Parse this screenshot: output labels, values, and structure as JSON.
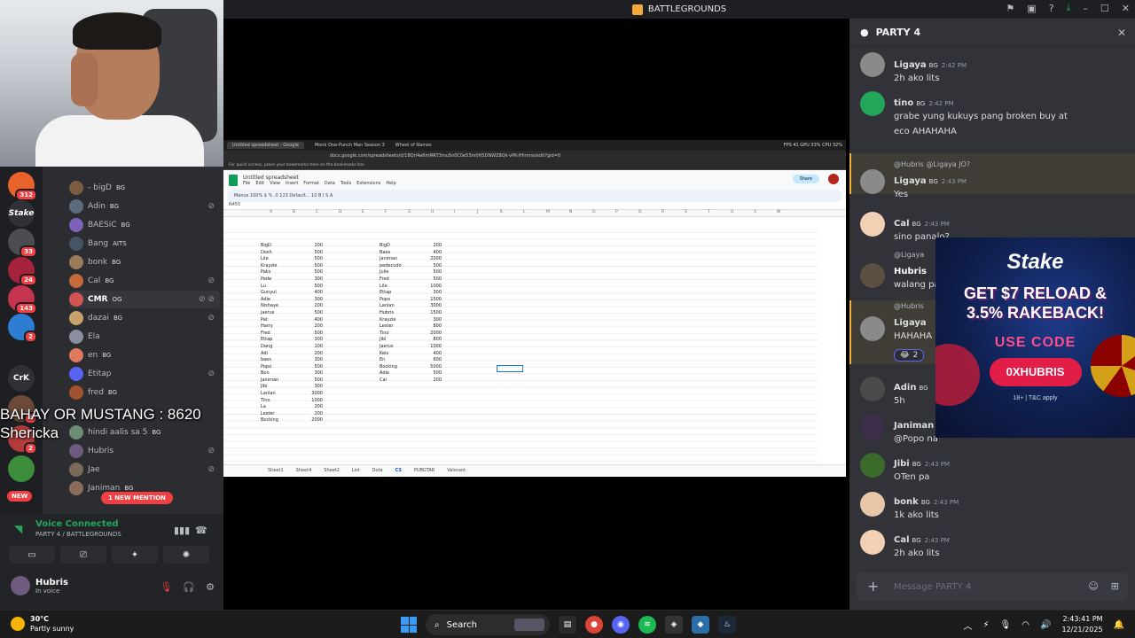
{
  "window": {
    "title": "BATTLEGROUNDS"
  },
  "overlay": {
    "line1": "BAHAY OR MUSTANG : 8620",
    "line2": "Shericka"
  },
  "rail": {
    "badges": [
      "312",
      "33",
      "24",
      "143",
      "2",
      "4",
      "2"
    ],
    "labels": [
      "Stake",
      "CrK"
    ],
    "new_label": "NEW"
  },
  "members": {
    "items": [
      {
        "name": "- bigD",
        "tag": "BG"
      },
      {
        "name": "Adin",
        "tag": "BG"
      },
      {
        "name": "BAESiC",
        "tag": "BG"
      },
      {
        "name": "Bang",
        "tag": "AITS"
      },
      {
        "name": "bonk",
        "tag": "BG"
      },
      {
        "name": "Cal",
        "tag": "BG"
      },
      {
        "name": "CMR",
        "tag": "OG"
      },
      {
        "name": "dazai",
        "tag": "BG"
      },
      {
        "name": "Ela",
        "tag": ""
      },
      {
        "name": "en",
        "tag": "BG"
      },
      {
        "name": "Etitap",
        "tag": ""
      },
      {
        "name": "fred",
        "tag": "BG"
      },
      {
        "name": "hindi aalis sa 5",
        "tag": "BG"
      },
      {
        "name": "Hubris",
        "tag": ""
      },
      {
        "name": "Jae",
        "tag": ""
      },
      {
        "name": "Janiman",
        "tag": "BG"
      }
    ],
    "mention_pill": "1 NEW MENTION"
  },
  "voice": {
    "status": "Voice Connected",
    "channel": "PARTY 4 / BATTLEGROUNDS",
    "user_name": "Hubris",
    "user_status": "In voice"
  },
  "stream": {
    "tabs": [
      "Untitled spreadsheet - Google",
      "Monk One-Punch Man Season 3",
      "Wheel of Names"
    ],
    "fps": "FPS 41   GPU 33%   CPU 32%",
    "url": "docs.google.com/spreadsheets/d/1BQrl4a6mMKT3mu5n0C0e53m0H5DNWZ8Qk-vPK-Hfmmo/edit?gid=0",
    "bookmark_bar": "For quick access, place your bookmarks here on the bookmarks bar.",
    "sheet_title": "Untitled spreadsheet",
    "menus": [
      "File",
      "Edit",
      "View",
      "Insert",
      "Format",
      "Data",
      "Tools",
      "Extensions",
      "Help"
    ],
    "share_label": "Share",
    "toolbar_text": "Menus   100%   $   %   .0   123   Default...   10   B   I   S   A",
    "cell_ref": "N455",
    "col_letters": [
      "A",
      "B",
      "C",
      "D",
      "E",
      "F",
      "G",
      "H",
      "I",
      "J",
      "K",
      "L",
      "M",
      "N",
      "O",
      "P",
      "Q",
      "R",
      "S",
      "T",
      "U",
      "V",
      "W"
    ],
    "left_table": [
      [
        "BigD",
        "200"
      ],
      [
        "Dosh",
        "500"
      ],
      [
        "Lile",
        "500"
      ],
      [
        "Krayzie",
        "500"
      ],
      [
        "Paks",
        "500"
      ],
      [
        "Pede",
        "300"
      ],
      [
        "Lu",
        "500"
      ],
      [
        "Gunyul",
        "400"
      ],
      [
        "Adie",
        "300"
      ],
      [
        "Nishaye",
        "200"
      ],
      [
        "jaerus",
        "500"
      ],
      [
        "Pat",
        "400"
      ],
      [
        "Harry",
        "200"
      ],
      [
        "Fred",
        "500"
      ],
      [
        "Ettap",
        "300"
      ],
      [
        "Dang",
        "100"
      ],
      [
        "Adi",
        "200"
      ],
      [
        "baes",
        "300"
      ],
      [
        "Popo",
        "500"
      ],
      [
        "Bon",
        "300"
      ],
      [
        "Janiman",
        "500"
      ],
      [
        "Jibi",
        "300"
      ],
      [
        "Lanlan",
        "3000"
      ],
      [
        "Tino",
        "1000"
      ],
      [
        "La",
        "200"
      ],
      [
        "Lester",
        "200"
      ],
      [
        "Bocking",
        "2000"
      ]
    ],
    "right_table": [
      [
        "BigD",
        "200"
      ],
      [
        "Baes",
        "400"
      ],
      [
        "Janiman",
        "2000"
      ],
      [
        "pedecudo",
        "500"
      ],
      [
        "Julie",
        "500"
      ],
      [
        "Fred",
        "500"
      ],
      [
        "Lile",
        "1000"
      ],
      [
        "Ettap",
        "300"
      ],
      [
        "Popo",
        "1500"
      ],
      [
        "Lanlan",
        "3000"
      ],
      [
        "Hubris",
        "1500"
      ],
      [
        "Krayzie",
        "300"
      ],
      [
        "Lester",
        "800"
      ],
      [
        "Tino",
        "2000"
      ],
      [
        "Jibi",
        "800"
      ],
      [
        "Jaerus",
        "1000"
      ],
      [
        "Kels",
        "400"
      ],
      [
        "En",
        "600"
      ],
      [
        "Bocking",
        "5000"
      ],
      [
        "Adie",
        "500"
      ],
      [
        "Cal",
        "200"
      ]
    ],
    "sheet_tabs": [
      "Sheet1",
      "Sheet4",
      "Sheet2",
      "List",
      "Dota",
      "CS",
      "PUBGTAR",
      "Valorant"
    ],
    "active_sheet": "CS"
  },
  "chat": {
    "title": "PARTY 4",
    "messages": [
      {
        "author": "Ligaya",
        "tag": "BG",
        "time": "2:42 PM",
        "text": "2h ako lits",
        "color": "#f0b232"
      },
      {
        "author": "tino",
        "tag": "BG",
        "time": "2:42 PM",
        "text": "grabe yung kukuys pang broken buy at eco AHAHAHA",
        "color": "#dbdee1"
      },
      {
        "reply": "@Hubris @Ligaya JO?",
        "author": "Ligaya",
        "tag": "BG",
        "time": "2:43 PM",
        "text": "Yes",
        "color": "#f0b232"
      },
      {
        "author": "Cal",
        "tag": "BG",
        "time": "2:43 PM",
        "text": "sino panalo?",
        "color": "#dbdee1"
      },
      {
        "reply": "@Ligaya",
        "author": "Hubris",
        "tag": "",
        "time": "",
        "text": "walang pa",
        "color": "#dbdee1"
      },
      {
        "reply": "@Hubris",
        "author": "Ligaya",
        "tag": "",
        "time": "",
        "text": "HAHAHA",
        "color": "#f0b232"
      },
      {
        "author": "Adin",
        "tag": "BG",
        "time": "",
        "text": "5h",
        "color": "#dbdee1"
      },
      {
        "author": "Janiman",
        "tag": "",
        "time": "",
        "text": "@Popo na",
        "color": "#dbdee1"
      },
      {
        "author": "Jibi",
        "tag": "BG",
        "time": "2:43 PM",
        "text": "OTen pa",
        "color": "#dbdee1"
      },
      {
        "author": "bonk",
        "tag": "BG",
        "time": "2:43 PM",
        "text": "1k ako lits",
        "color": "#dbdee1"
      },
      {
        "author": "Cal",
        "tag": "BG",
        "time": "2:43 PM",
        "text": "2h ako lits",
        "color": "#dbdee1"
      }
    ],
    "reaction_count": "2",
    "input_placeholder": "Message PARTY 4"
  },
  "ad": {
    "brand": "Stake",
    "headline1": "GET $7 RELOAD &",
    "headline2": "3.5% RAKEBACK!",
    "use_code": "USE CODE",
    "code": "0XHUBRIS",
    "tc": "18+ | T&C apply"
  },
  "taskbar": {
    "temp": "30°C",
    "weather": "Partly sunny",
    "search": "Search",
    "time": "2:43:41 PM",
    "date": "12/21/2025"
  }
}
